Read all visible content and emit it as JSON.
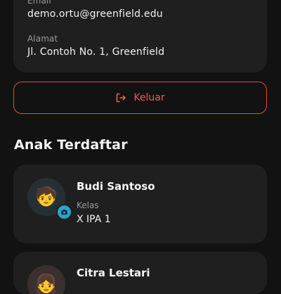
{
  "profile": {
    "email_label": "Email",
    "email_value": "demo.ortu@greenfield.edu",
    "address_label": "Alamat",
    "address_value": "Jl. Contoh No. 1, Greenfield"
  },
  "logout": {
    "label": "Keluar",
    "icon": "logout-icon",
    "color": "#e14b4b"
  },
  "children_section": {
    "title": "Anak Terdaftar",
    "children": [
      {
        "name": "Budi Santoso",
        "class_label": "Kelas",
        "class_value": "X IPA 1",
        "avatar": "boy-emoji"
      },
      {
        "name": "Citra Lestari",
        "avatar": "child-emoji"
      }
    ]
  },
  "colors": {
    "background": "#121212",
    "card": "#1f1f1f",
    "accent": "#2aa4c8",
    "danger": "#e14b4b"
  }
}
